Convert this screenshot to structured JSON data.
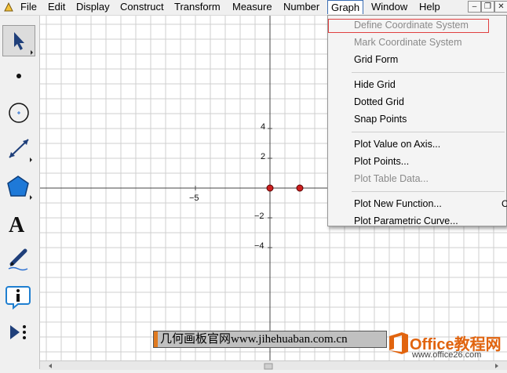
{
  "menubar": {
    "items": [
      "File",
      "Edit",
      "Display",
      "Construct",
      "Transform",
      "Measure",
      "Number",
      "Graph",
      "Window",
      "Help"
    ],
    "active": "Graph",
    "window_controls": [
      "–",
      "❐",
      "✕"
    ]
  },
  "toolbox": {
    "tools": [
      "selection-arrow-tool",
      "point-tool",
      "compass-tool",
      "straightedge-tool",
      "polygon-tool",
      "text-tool",
      "marker-tool",
      "information-tool",
      "custom-tool"
    ],
    "selected": "selection-arrow-tool",
    "text_tool_glyph": "A"
  },
  "graph_menu": {
    "items": [
      {
        "label": "Define Coordinate System",
        "enabled": false,
        "highlighted": true
      },
      {
        "label": "Mark Coordinate System",
        "enabled": false
      },
      {
        "label": "Grid Form",
        "enabled": true
      },
      {
        "separator": true
      },
      {
        "label": "Hide Grid",
        "enabled": true
      },
      {
        "label": "Dotted Grid",
        "enabled": true
      },
      {
        "label": "Snap Points",
        "enabled": true
      },
      {
        "separator": true
      },
      {
        "label": "Plot Value on Axis...",
        "enabled": true
      },
      {
        "label": "Plot Points...",
        "enabled": true
      },
      {
        "label": "Plot Table Data...",
        "enabled": false
      },
      {
        "separator": true
      },
      {
        "label": "Plot New Function...",
        "enabled": true,
        "shortcut": "Ct"
      },
      {
        "label": "Plot Parametric Curve...",
        "enabled": true
      }
    ]
  },
  "graph": {
    "x_ticks": [
      {
        "value": -5,
        "label": "−5"
      }
    ],
    "y_ticks": [
      {
        "value": 4,
        "label": "4"
      },
      {
        "value": 2,
        "label": "2"
      },
      {
        "value": -2,
        "label": "−2"
      },
      {
        "value": -4,
        "label": "−4"
      }
    ],
    "points": [
      {
        "x": 0,
        "y": 0
      },
      {
        "x": 1,
        "y": 0
      }
    ],
    "point_color": "#cc1f1f",
    "grid_color": "#cfcfcf",
    "axis_color": "#444444"
  },
  "watermarks": {
    "left_text": "几何画板官网www.jihehuaban.com.cn",
    "brand": "Office教程网",
    "site": "www.office26.com",
    "brand_color": "#e1640f"
  }
}
